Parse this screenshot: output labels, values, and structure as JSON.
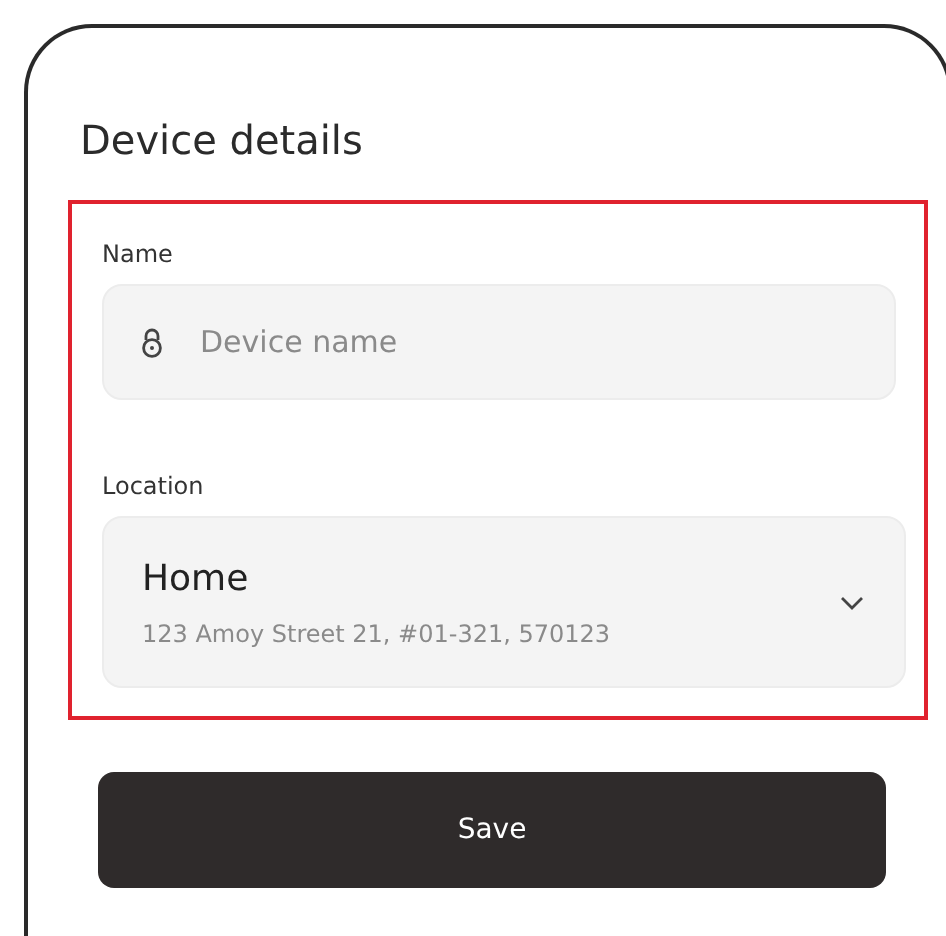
{
  "title": "Device details",
  "form": {
    "highlighted": true,
    "name": {
      "label": "Name",
      "placeholder": "Device name"
    },
    "location": {
      "label": "Location",
      "value": "Home",
      "address": "123 Amoy Street 21, #01-321, 570123"
    }
  },
  "buttons": [
    "Save"
  ]
}
